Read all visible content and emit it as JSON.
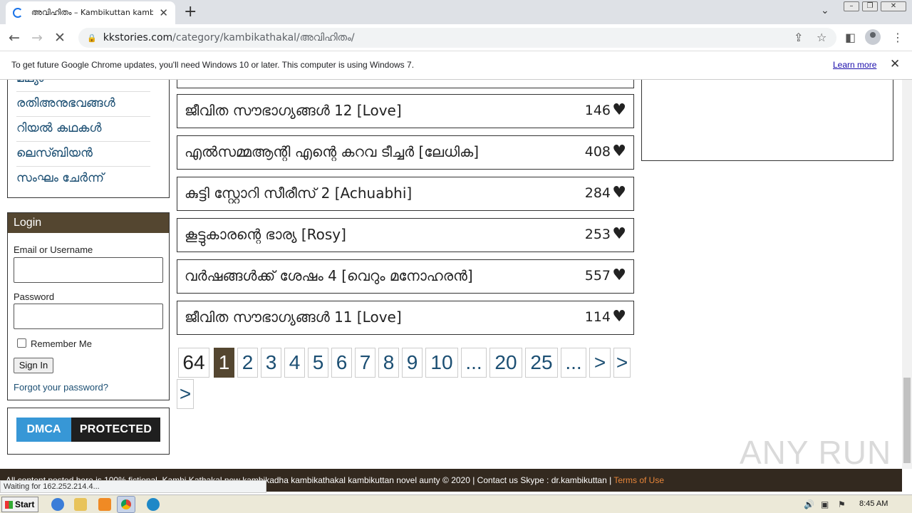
{
  "browser": {
    "tab_title": "അവിഹിതം – Kambikuttan kambi",
    "new_tab": "+",
    "url_host": "kkstories.com",
    "url_path": "/category/kambikathakal/അവിഹിതം/",
    "info_text": "To get future Google Chrome updates, you'll need Windows 10 or later. This computer is using Windows 7.",
    "learn_more": "Learn more"
  },
  "sidebar": {
    "categories": [
      "മഥ്യം",
      "രതിഅനുഭവങ്ങൾ",
      "റിയൽ കഥകൾ",
      "ലെസ്ബിയൻ",
      "സംഘം ചേർന്ന്"
    ]
  },
  "login": {
    "heading": "Login",
    "username_label": "Email or Username",
    "password_label": "Password",
    "remember_label": "Remember Me",
    "signin_label": "Sign In",
    "forgot_label": "Forgot your password?"
  },
  "dmca": {
    "left": "DMCA",
    "right": "PROTECTED"
  },
  "stories": [
    {
      "title": "ജീവിത സൗഭാഗ്യങ്ങൾ 12 [Love]",
      "likes": "146"
    },
    {
      "title": "എൽസമ്മആന്റി എന്റെ കറവ ടീച്ചർ [ലേധിക]",
      "likes": "408"
    },
    {
      "title": "കുട്ടി സ്റ്റോറി സീരീസ് 2 [Achuabhi]",
      "likes": "284"
    },
    {
      "title": "കൂട്ടുകാരന്റെ ഭാര്യ [Rosy]",
      "likes": "253"
    },
    {
      "title": "വർഷങ്ങൾക്ക് ശേഷം 4 [വെറും മനോഹരൻ]",
      "likes": "557"
    },
    {
      "title": "ജീവിത സൗഭാഗ്യങ്ങൾ 11 [Love]",
      "likes": "114"
    }
  ],
  "pagination": [
    "64",
    "1",
    "2",
    "3",
    "4",
    "5",
    "6",
    "7",
    "8",
    "9",
    "10",
    "...",
    "20",
    "25",
    "...",
    ">",
    ">",
    ">"
  ],
  "watermark": "ANY RUN",
  "footer": {
    "text": "All content posted here is 100% fictional. Kambi Kathakal new kambikadha kambikathakal kambikuttan novel aunty © 2020 | Contact us Skype : dr.kambikuttan | ",
    "terms": "Terms of Use"
  },
  "status": "Waiting for 162.252.214.4...",
  "taskbar": {
    "start": "Start",
    "clock": "8:45 AM"
  },
  "colors": {
    "accent": "#544630",
    "link": "#1c4f73",
    "footer_bg": "#33291f"
  }
}
